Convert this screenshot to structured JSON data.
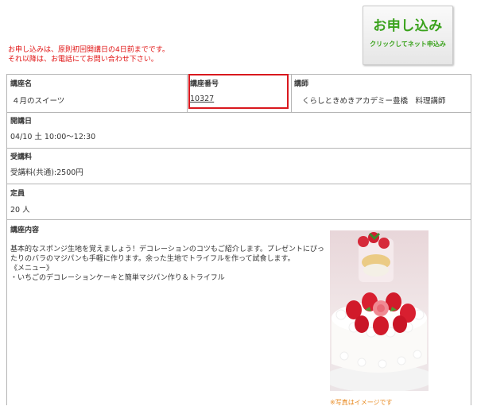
{
  "notice": {
    "line1": "お申し込みは、原則初回開講日の4日前までです。",
    "line2": "それ以降は、お電話にてお問い合わせ下さい。"
  },
  "apply_button": {
    "main": "お申し込み",
    "sub": "クリックしてネット申込み"
  },
  "course": {
    "name_label": "講座名",
    "name_value": "４月のスイーツ",
    "number_label": "講座番号",
    "number_value": "10327",
    "instructor_label": "講師",
    "instructor_value": "くらしときめきアカデミー豊橋　料理講師"
  },
  "date": {
    "label": "開講日",
    "value": "04/10 土 10:00～12:30"
  },
  "fee": {
    "label": "受講料",
    "value": "受講料(共通):2500円"
  },
  "capacity": {
    "label": "定員",
    "value": "20 人"
  },
  "content": {
    "label": "講座内容",
    "lines": [
      "基本的なスポンジ生地を覚えましょう！デコレーションのコツもご紹介します。プレゼントにぴっ",
      "たりのバラのマジパンも手軽に作ります。余った生地でトライフルを作って試食します。",
      "《メニュー》",
      "・いちごのデコレーションケーキと簡単マジパン作り＆トライフル"
    ],
    "caption": "※写真はイメージです"
  },
  "colors": {
    "notice": "#e01010",
    "apply_green": "#3aa21c",
    "highlight": "#d9181e",
    "caption": "#e8891f"
  }
}
